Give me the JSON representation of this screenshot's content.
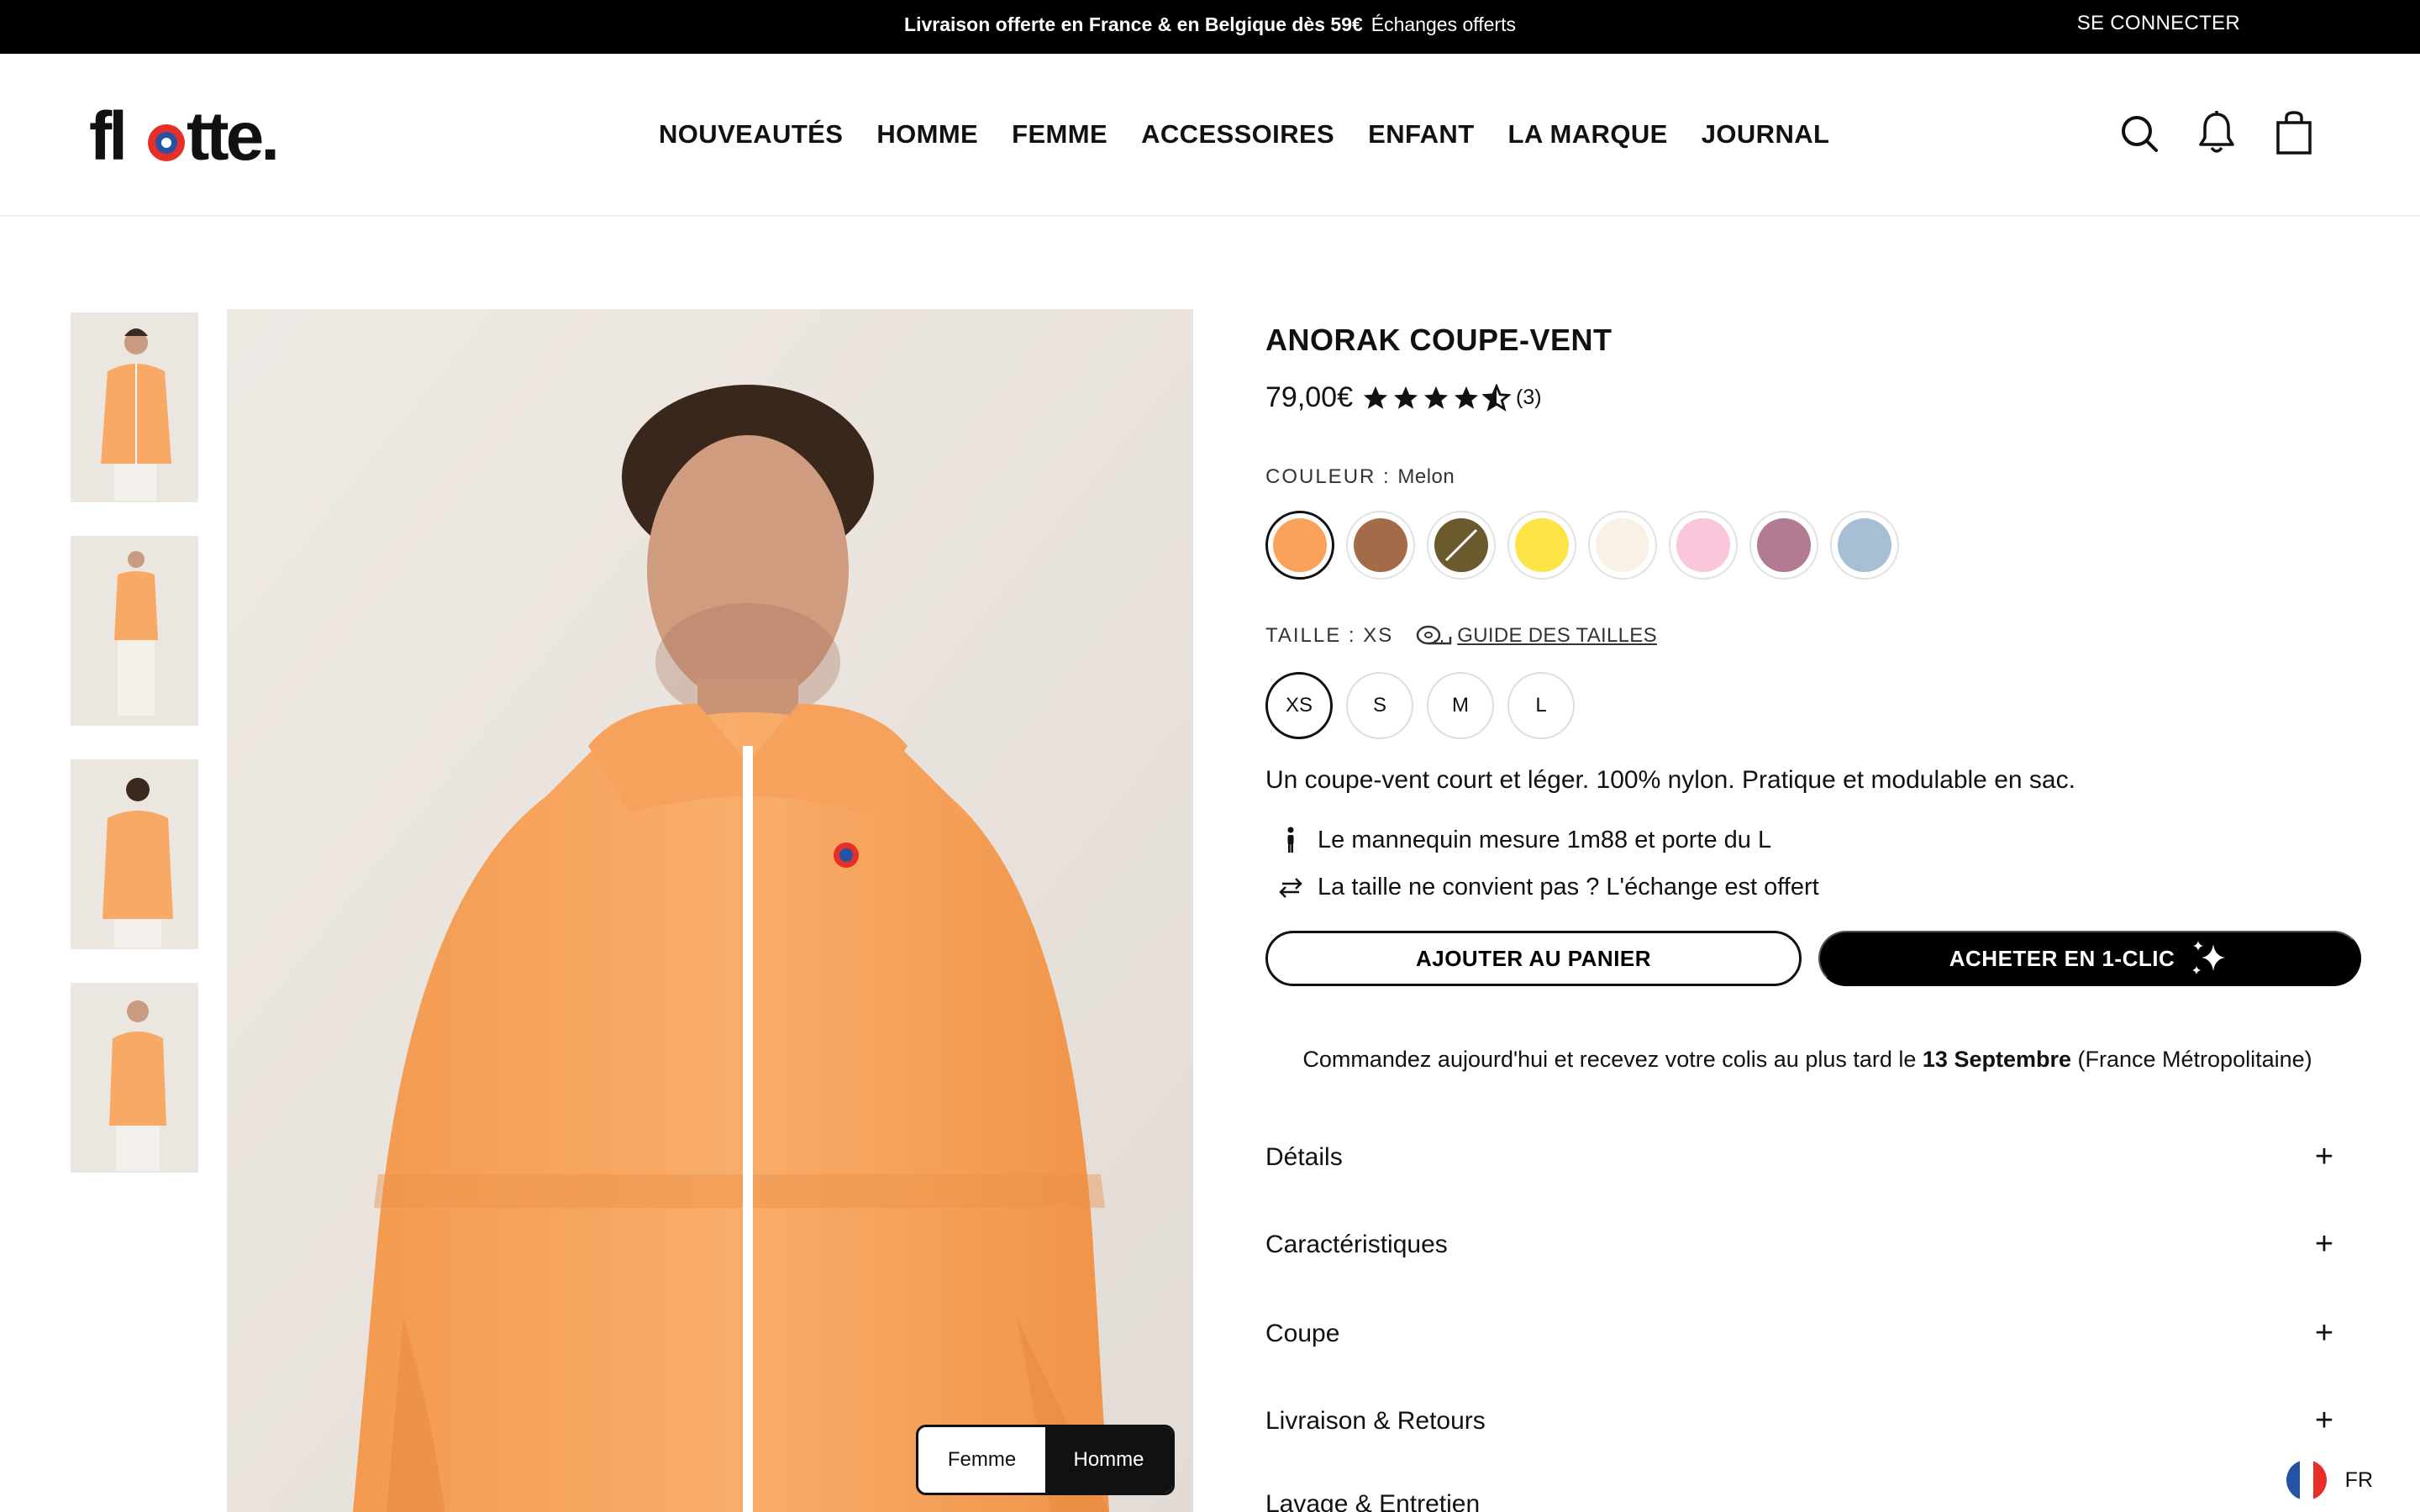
{
  "topbar": {
    "promo_bold": "Livraison offerte en France & en Belgique dès 59€",
    "promo_extra": "Échanges offerts",
    "login": "SE CONNECTER"
  },
  "header": {
    "logo_text": "flotte.",
    "nav": [
      "NOUVEAUTÉS",
      "HOMME",
      "FEMME",
      "ACCESSOIRES",
      "ENFANT",
      "LA MARQUE",
      "JOURNAL"
    ],
    "icons": [
      "search-icon",
      "bell-icon",
      "bag-icon"
    ]
  },
  "gallery": {
    "thumbnail_count": 4,
    "active_thumbnail": 1,
    "gender_toggle": {
      "femme": "Femme",
      "homme": "Homme",
      "selected": "Homme"
    }
  },
  "product": {
    "title": "ANORAK COUPE-VENT",
    "price": "79,00€",
    "rating": 4.5,
    "review_count": "(3)",
    "color_label": "COULEUR :",
    "color_value": "Melon",
    "swatches": [
      {
        "name": "Melon",
        "color": "#f9a25c",
        "selected": true
      },
      {
        "name": "brown",
        "color": "#a36b48"
      },
      {
        "name": "olive",
        "color": "#6b5a2d",
        "unavailable": true
      },
      {
        "name": "yellow",
        "color": "#fde446"
      },
      {
        "name": "cream",
        "color": "#f7f1e6"
      },
      {
        "name": "pink",
        "color": "#f9c6dc"
      },
      {
        "name": "mauve",
        "color": "#b27a93"
      },
      {
        "name": "blue",
        "color": "#a7bfd4"
      }
    ],
    "size_label": "TAILLE : XS",
    "size_guide": "GUIDE DES TAILLES",
    "sizes": [
      "XS",
      "S",
      "M",
      "L"
    ],
    "selected_size": "XS",
    "description": "Un coupe-vent court et léger. 100% nylon. Pratique et modulable en sac.",
    "model_info": "Le mannequin mesure 1m88 et porte du L",
    "exchange_info": "La taille ne convient pas ? L'échange est offert",
    "add_to_cart": "AJOUTER AU PANIER",
    "buy_now": "ACHETER EN 1-CLIC",
    "delivery_before": "Commandez aujourd'hui et recevez votre colis au plus tard le",
    "delivery_date": "13 Septembre",
    "delivery_after": "(France Métropolitaine)",
    "accordions": [
      "Détails",
      "Caractéristiques",
      "Coupe",
      "Livraison & Retours",
      "Lavage & Entretien"
    ]
  },
  "lang": {
    "code": "FR"
  },
  "colors": {
    "accent": "#000000",
    "jacket": "#f8a965"
  }
}
